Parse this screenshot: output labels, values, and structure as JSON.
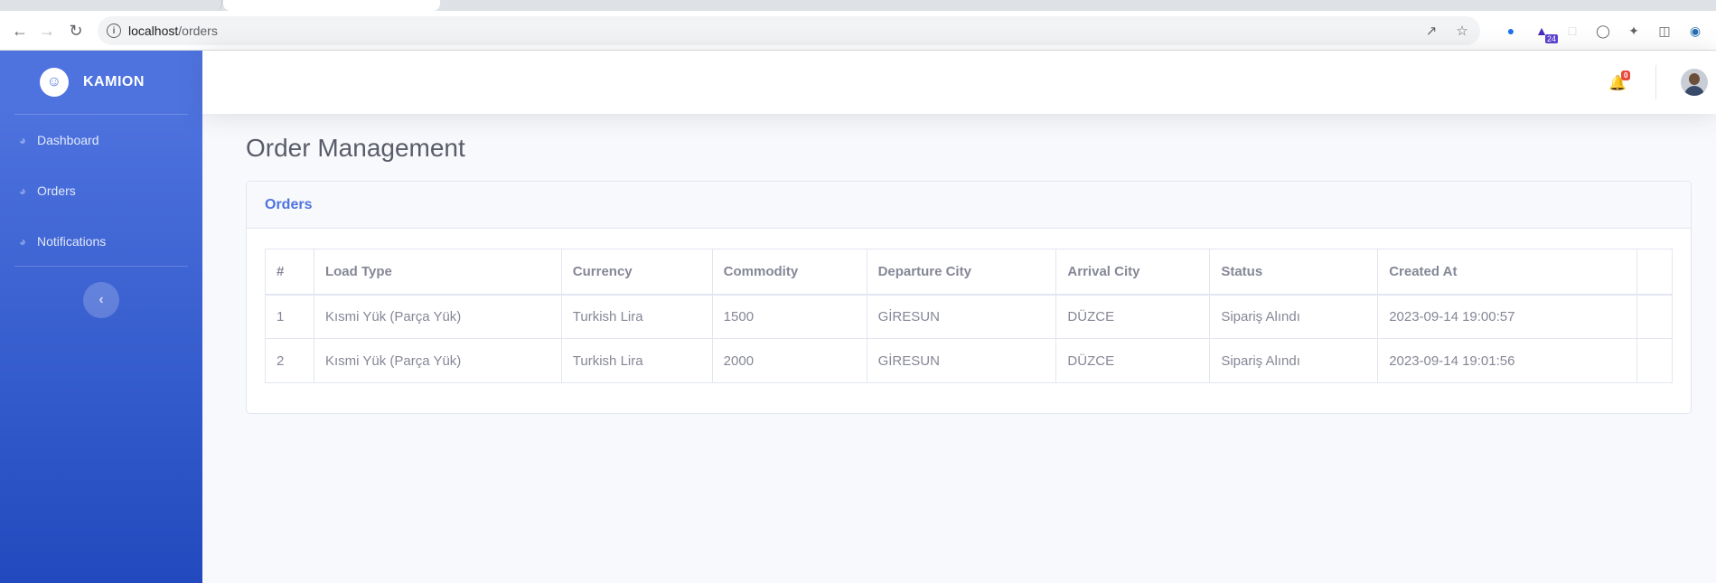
{
  "browser": {
    "url_host": "localhost",
    "url_path": "/orders",
    "extension_badge": "24"
  },
  "sidebar": {
    "brand": "KAMION",
    "items": [
      {
        "label": "Dashboard",
        "icon": "dashboard-icon"
      },
      {
        "label": "Orders",
        "icon": "dashboard-icon"
      },
      {
        "label": "Notifications",
        "icon": "dashboard-icon"
      }
    ],
    "toggle_icon": "chevron-left-icon"
  },
  "topbar": {
    "notification_count": "0"
  },
  "page": {
    "title": "Order Management"
  },
  "card": {
    "title": "Orders",
    "columns": [
      "#",
      "Load Type",
      "Currency",
      "Commodity",
      "Departure City",
      "Arrival City",
      "Status",
      "Created At",
      ""
    ],
    "rows": [
      [
        "1",
        "Kısmi Yük (Parça Yük)",
        "Turkish Lira",
        "1500",
        "GİRESUN",
        "DÜZCE",
        "Sipariş Alındı",
        "2023-09-14 19:00:57",
        ""
      ],
      [
        "2",
        "Kısmi Yük (Parça Yük)",
        "Turkish Lira",
        "2000",
        "GİRESUN",
        "DÜZCE",
        "Sipariş Alındı",
        "2023-09-14 19:01:56",
        ""
      ]
    ]
  },
  "colors": {
    "sidebar_gradient_top": "#4e73df",
    "sidebar_gradient_bottom": "#224abe",
    "accent": "#4e73df",
    "badge_red": "#e74a3b"
  }
}
